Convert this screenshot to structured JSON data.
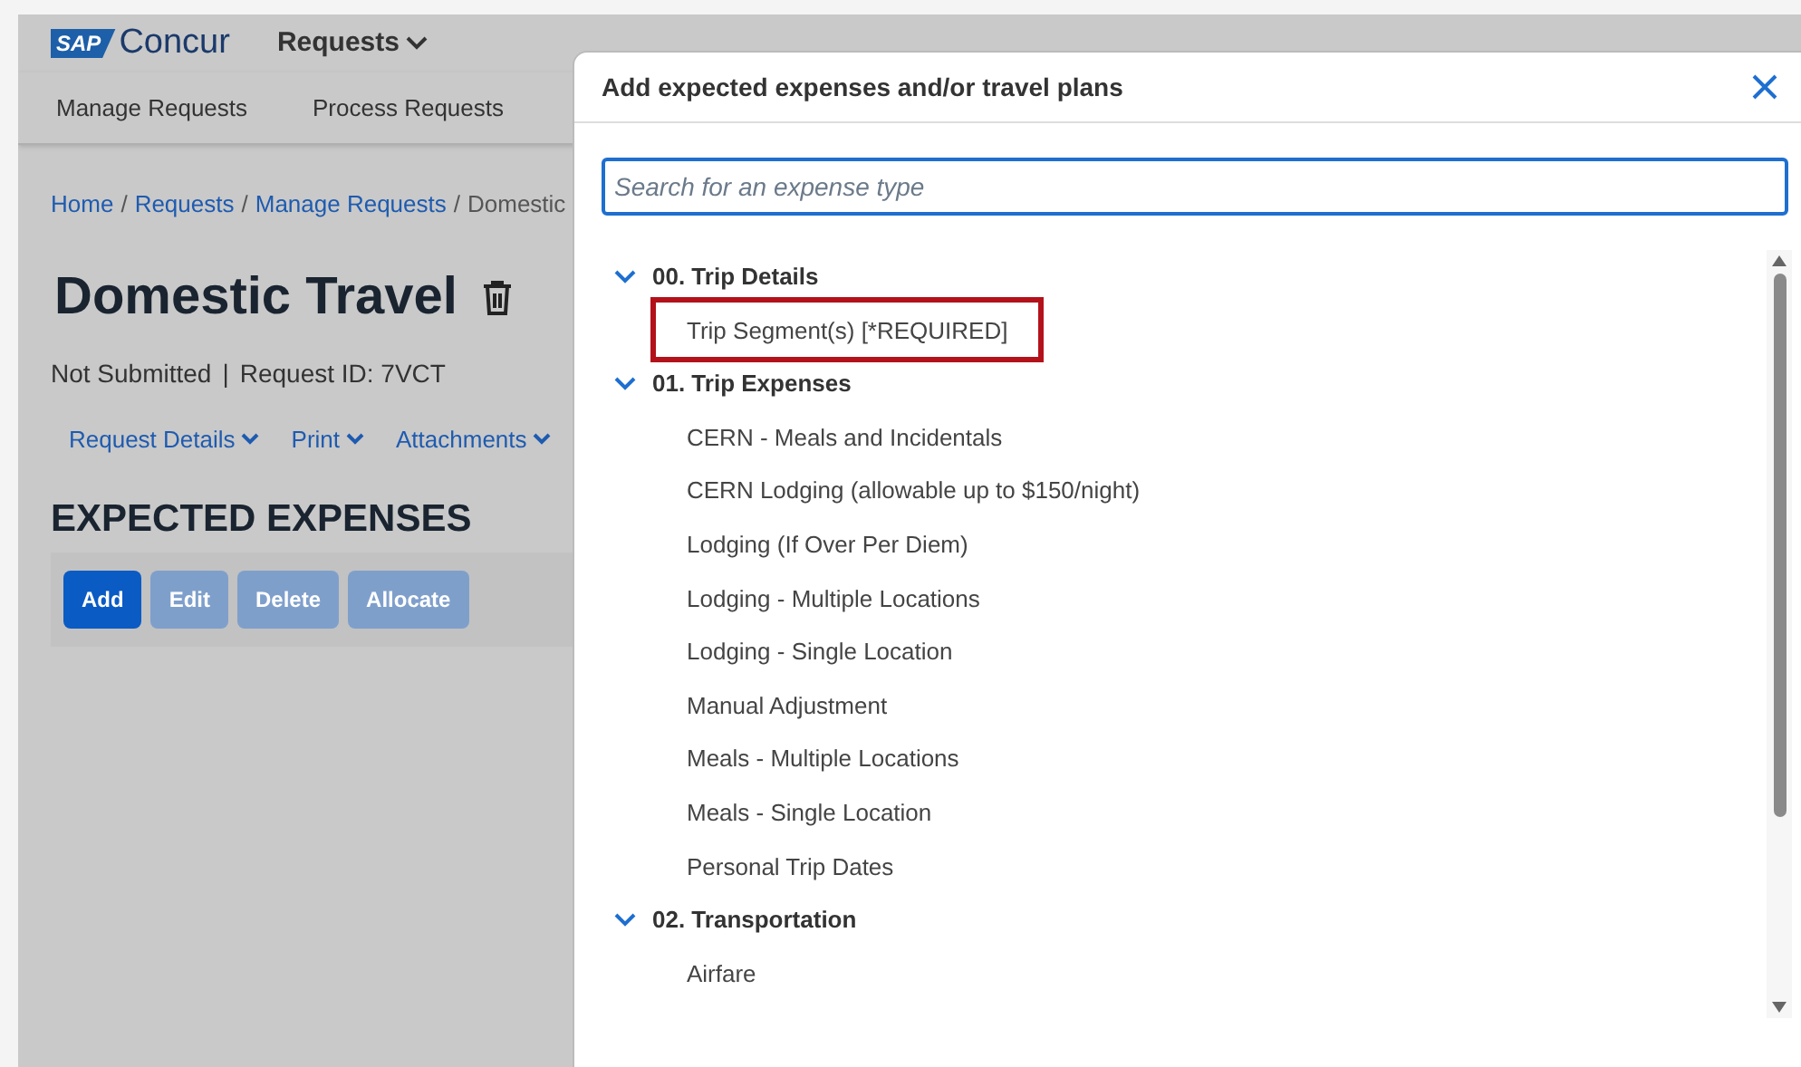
{
  "app": {
    "logo_badge": "SAP",
    "logo_text": "Concur",
    "menu": "Requests",
    "subnav": [
      "Manage Requests",
      "Process Requests"
    ]
  },
  "breadcrumb": [
    {
      "label": "Home",
      "kind": "link"
    },
    {
      "label": "Requests",
      "kind": "link"
    },
    {
      "label": "Manage Requests",
      "kind": "link"
    },
    {
      "label": "Domestic",
      "kind": "current"
    }
  ],
  "breadcrumb_separator": "/",
  "request": {
    "title": "Domestic Travel",
    "status": "Not Submitted",
    "divider": "|",
    "request_id": "Request ID: 7VCT"
  },
  "request_menus": [
    "Request Details",
    "Print",
    "Attachments"
  ],
  "section_title": "EXPECTED EXPENSES",
  "actions": [
    {
      "label": "Add",
      "disabled": false
    },
    {
      "label": "Edit",
      "disabled": true
    },
    {
      "label": "Delete",
      "disabled": true
    },
    {
      "label": "Allocate",
      "disabled": true
    }
  ],
  "dialog": {
    "title": "Add expected expenses and/or travel plans",
    "search": {
      "placeholder": "Search for an expense type"
    },
    "groups": [
      {
        "label": "00. Trip Details",
        "expanded": true,
        "children": [
          {
            "label": "Trip Segment(s) [*REQUIRED]",
            "highlighted": true
          }
        ]
      },
      {
        "label": "01. Trip Expenses",
        "expanded": true,
        "children": [
          {
            "label": "CERN - Meals and Incidentals",
            "highlighted": false
          },
          {
            "label": "CERN Lodging (allowable up to $150/night)",
            "highlighted": false
          },
          {
            "label": "Lodging (If Over Per Diem)",
            "highlighted": false
          },
          {
            "label": "Lodging - Multiple Locations",
            "highlighted": false
          },
          {
            "label": "Lodging - Single Location",
            "highlighted": false
          },
          {
            "label": "Manual Adjustment",
            "highlighted": false
          },
          {
            "label": "Meals - Multiple Locations",
            "highlighted": false
          },
          {
            "label": "Meals - Single Location",
            "highlighted": false
          },
          {
            "label": "Personal Trip Dates",
            "highlighted": false
          }
        ]
      },
      {
        "label": "02. Transportation",
        "expanded": true,
        "children": [
          {
            "label": "Airfare",
            "highlighted": false
          }
        ]
      }
    ]
  }
}
